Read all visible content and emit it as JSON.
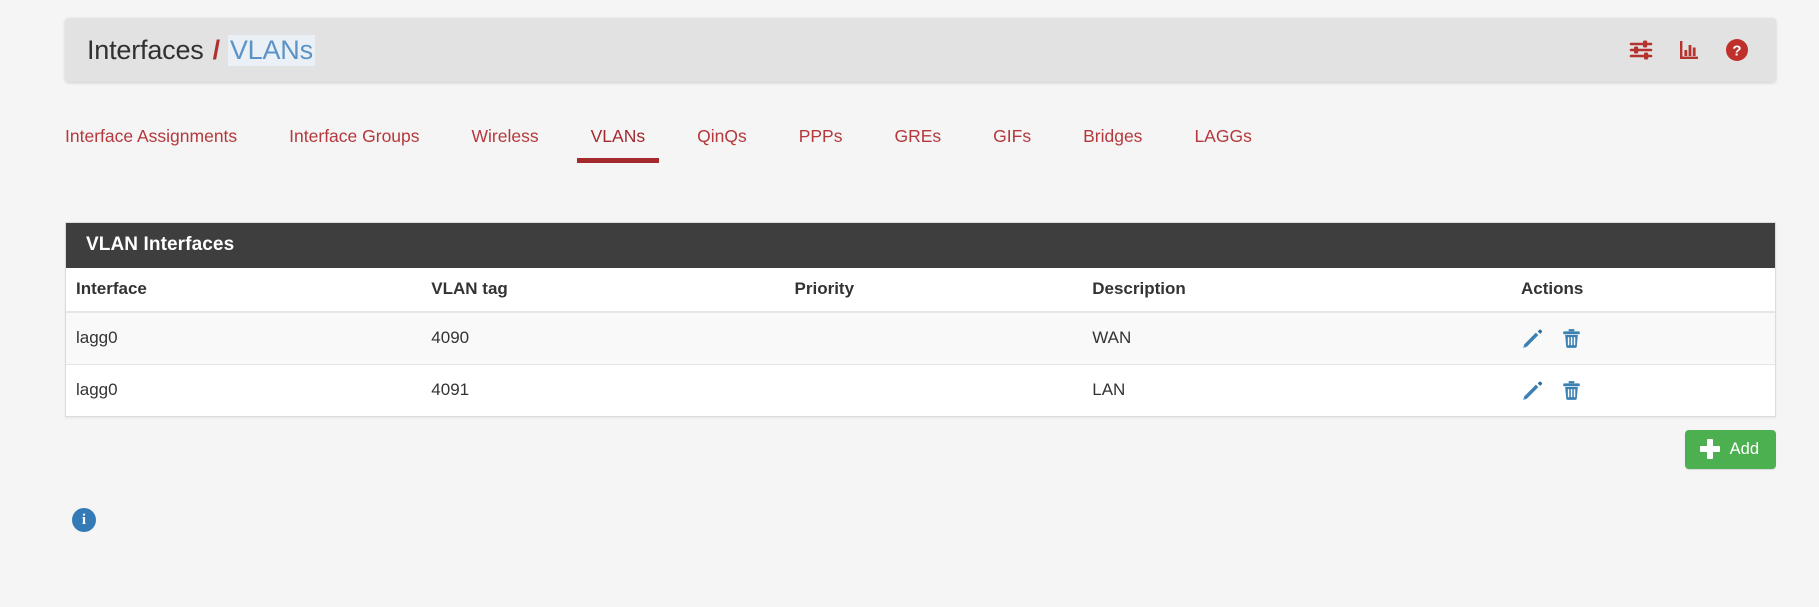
{
  "header": {
    "breadcrumb_root": "Interfaces",
    "breadcrumb_separator": "/",
    "breadcrumb_current": "VLANs",
    "icons": [
      {
        "name": "sliders-icon",
        "title": "Advanced"
      },
      {
        "name": "bar-chart-icon",
        "title": "Status"
      },
      {
        "name": "help-icon",
        "title": "Help"
      }
    ]
  },
  "tabs": [
    {
      "label": "Interface Assignments",
      "active": false
    },
    {
      "label": "Interface Groups",
      "active": false
    },
    {
      "label": "Wireless",
      "active": false
    },
    {
      "label": "VLANs",
      "active": true
    },
    {
      "label": "QinQs",
      "active": false
    },
    {
      "label": "PPPs",
      "active": false
    },
    {
      "label": "GREs",
      "active": false
    },
    {
      "label": "GIFs",
      "active": false
    },
    {
      "label": "Bridges",
      "active": false
    },
    {
      "label": "LAGGs",
      "active": false
    }
  ],
  "panel": {
    "title": "VLAN Interfaces",
    "columns": [
      "Interface",
      "VLAN tag",
      "Priority",
      "Description",
      "Actions"
    ],
    "rows": [
      {
        "interface": "lagg0",
        "vlan_tag": "4090",
        "priority": "",
        "description": "WAN"
      },
      {
        "interface": "lagg0",
        "vlan_tag": "4091",
        "priority": "",
        "description": "LAN"
      }
    ],
    "row_actions": [
      {
        "name": "edit-icon",
        "title": "Edit VLAN"
      },
      {
        "name": "delete-icon",
        "title": "Delete VLAN"
      }
    ]
  },
  "add_button": {
    "label": "Add"
  },
  "info": {
    "symbol": "i"
  },
  "colors": {
    "accent_red": "#b5383c",
    "active_tab_underline": "#a4292d",
    "panel_heading_bg": "#3e3e3e",
    "action_icon_blue": "#337ab7",
    "add_button_green": "#4caf50",
    "breadcrumb_link": "#5b93c7",
    "page_bg": "#f5f5f5"
  }
}
